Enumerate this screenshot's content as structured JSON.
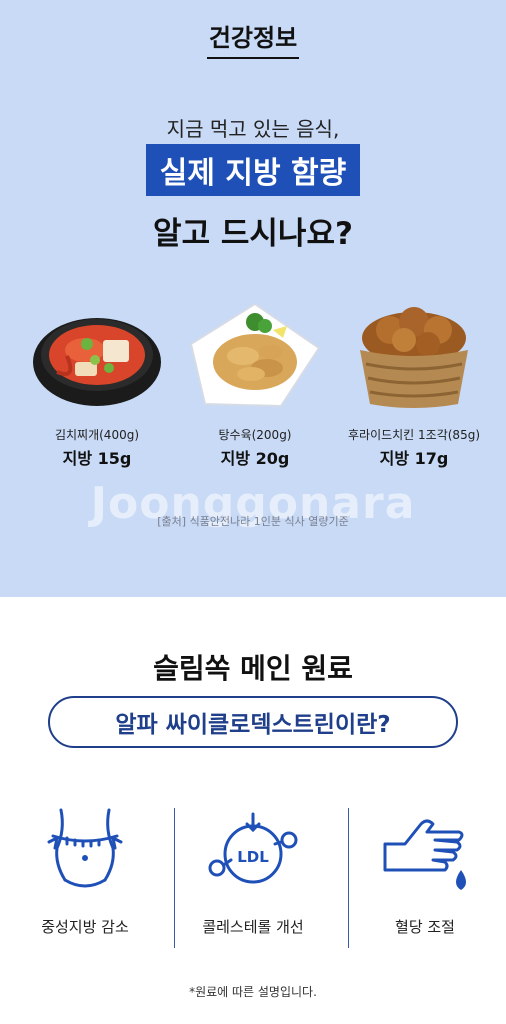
{
  "header": {
    "title": "건강정보"
  },
  "intro": {
    "lead": "지금 먹고 있는 음식,",
    "highlight": "실제 지방 함량",
    "question": "알고 드시나요?"
  },
  "foods": [
    {
      "name": "김치찌개(400g)",
      "fat": "지방 15g",
      "icon": "kimchi-stew-icon"
    },
    {
      "name": "탕수육(200g)",
      "fat": "지방 20g",
      "icon": "sweet-sour-pork-icon"
    },
    {
      "name": "후라이드치킨 1조각(85g)",
      "fat": "지방 17g",
      "icon": "fried-chicken-icon"
    }
  ],
  "watermark": "Joonggonara",
  "source": "[출처] 식품안전나라 1인분 식사 열량기준",
  "ingredient": {
    "title": "슬림쏙 메인 원료",
    "pill": "알파 싸이클로덱스트린이란?"
  },
  "benefits": [
    {
      "label": "중성지방 감소",
      "icon": "waist-measure-icon"
    },
    {
      "label": "콜레스테롤 개선",
      "icon": "ldl-molecule-icon",
      "icon_text": "LDL"
    },
    {
      "label": "혈당 조절",
      "icon": "hand-drop-icon"
    }
  ],
  "footnote": "*원료에 따른 설명입니다.",
  "colors": {
    "top_bg": "#c8daf6",
    "accent": "#1f50b8",
    "pill": "#1f3f8a"
  }
}
